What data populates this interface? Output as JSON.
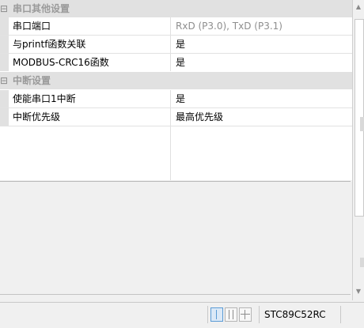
{
  "property_grid": {
    "sections": [
      {
        "title": "串口其他设置",
        "rows": [
          {
            "name": "串口端口",
            "value": "RxD (P3.0), TxD (P3.1)",
            "disabled": true
          },
          {
            "name": "与printf函数关联",
            "value": "是"
          },
          {
            "name": "MODBUS-CRC16函数",
            "value": "是"
          }
        ]
      },
      {
        "title": "中断设置",
        "rows": [
          {
            "name": "使能串口1中断",
            "value": "是"
          },
          {
            "name": "中断优先级",
            "value": "最高优先级"
          }
        ]
      }
    ],
    "collapse_glyph": "⊟"
  },
  "status_bar": {
    "device": "STC89C52RC",
    "active_view": "split-vertical"
  }
}
